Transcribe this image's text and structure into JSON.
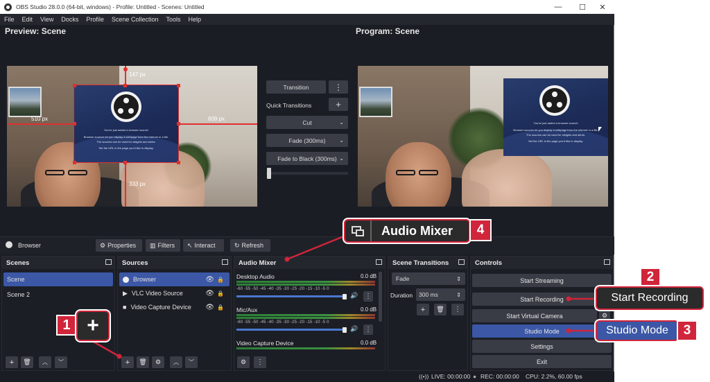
{
  "window": {
    "title": "OBS Studio 28.0.0 (64-bit, windows) - Profile: Untitled - Scenes: Untitled",
    "controls": {
      "minimize": "—",
      "maximize": "☐",
      "close": "✕"
    }
  },
  "menu": [
    "File",
    "Edit",
    "View",
    "Docks",
    "Profile",
    "Scene Collection",
    "Tools",
    "Help"
  ],
  "preview": {
    "label": "Preview: Scene",
    "measure_top": "147 px",
    "measure_left": "510 px",
    "measure_right": "609 px",
    "measure_bottom": "333 px"
  },
  "program": {
    "label": "Program: Scene"
  },
  "browser_source_text": {
    "line1": "You've just added a browser source!",
    "line2": "Browser sources let you display a webpage from the internet or a file.",
    "line3": "The sources can be used for widgets and alerts.",
    "line4": "Set the URL in the page you'd like to display."
  },
  "transition_panel": {
    "transition_button": "Transition",
    "more_icon": "⋮",
    "quick_transitions_label": "Quick Transitions",
    "add_icon": "+",
    "options": [
      "Cut",
      "Fade (300ms)",
      "Fade to Black (300ms)"
    ],
    "tbar_value": 0
  },
  "context_bar": {
    "source_name": "Browser",
    "buttons": [
      "Properties",
      "Filters",
      "Interact",
      "Refresh"
    ]
  },
  "docks": {
    "scenes": {
      "title": "Scenes",
      "items": [
        "Scene",
        "Scene 2"
      ],
      "selected_index": 0
    },
    "sources": {
      "title": "Sources",
      "items": [
        {
          "name": "Browser",
          "icon": "globe-icon"
        },
        {
          "name": "VLC Video Source",
          "icon": "play-icon"
        },
        {
          "name": "Video Capture Device",
          "icon": "camera-icon"
        }
      ],
      "selected_index": 0
    },
    "audio_mixer": {
      "title": "Audio Mixer",
      "channels": [
        {
          "name": "Desktop Audio",
          "level": "0.0 dB",
          "volume": 0.92
        },
        {
          "name": "Mic/Aux",
          "level": "0.0 dB",
          "volume": 0.92
        },
        {
          "name": "Video Capture Device",
          "level": "0.0 dB",
          "volume": 0.92
        }
      ],
      "scale": "-60 -55 -50 -45 -40 -35 -30 -25 -20 -15 -10 -5 0"
    },
    "scene_transitions": {
      "title": "Scene Transitions",
      "selected": "Fade",
      "duration_label": "Duration",
      "duration_value": "300 ms"
    },
    "controls": {
      "title": "Controls",
      "buttons": [
        "Start Streaming",
        "Start Recording",
        "Start Virtual Camera",
        "Studio Mode",
        "Settings",
        "Exit"
      ],
      "active_index": 3
    }
  },
  "status": {
    "live": "LIVE: 00:00:00",
    "rec": "REC: 00:00:00",
    "cpu": "CPU: 2.2%, 60.00 fps"
  },
  "callouts": {
    "c1": {
      "number": "1",
      "symbol": "+"
    },
    "c2": {
      "number": "2",
      "text": "Start Recording"
    },
    "c3": {
      "number": "3",
      "text": "Studio Mode"
    },
    "c4": {
      "number": "4",
      "text": "Audio Mixer"
    }
  },
  "colors": {
    "accent_blue": "#3b57a6",
    "callout_red": "#d0253a",
    "panel_bg": "#1c1e25",
    "transform_red": "#e03030"
  }
}
